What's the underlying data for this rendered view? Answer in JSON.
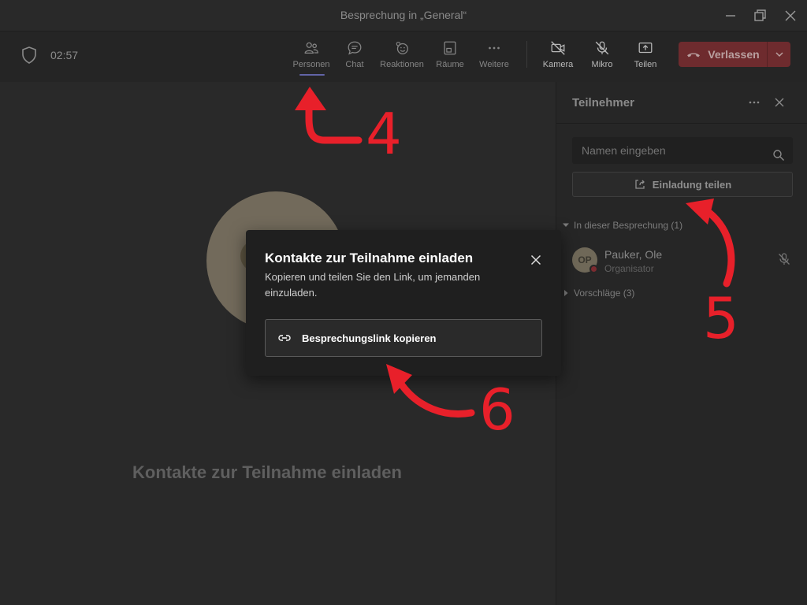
{
  "window": {
    "title": "Besprechung in „General“"
  },
  "toolbar": {
    "timer": "02:57",
    "buttons": {
      "people": "Personen",
      "chat": "Chat",
      "reactions": "Reaktionen",
      "rooms": "Räume",
      "more": "Weitere",
      "camera": "Kamera",
      "mic": "Mikro",
      "share": "Teilen"
    },
    "leave_label": "Verlassen"
  },
  "stage": {
    "title": "Kontakte zur Teilnahme einladen"
  },
  "panel": {
    "title": "Teilnehmer",
    "search_placeholder": "Namen eingeben",
    "share_invite_label": "Einladung teilen",
    "section_in_meeting": "In dieser Besprechung (1)",
    "section_suggestions": "Vorschläge (3)",
    "participants": [
      {
        "initials": "OP",
        "name": "Pauker, Ole",
        "role": "Organisator"
      }
    ]
  },
  "modal": {
    "title": "Kontakte zur Teilnahme einladen",
    "description": "Kopieren und teilen Sie den Link, um jemanden einzuladen.",
    "copy_button": "Besprechungslink kopieren"
  },
  "annotations": {
    "marker_4": "4",
    "marker_5": "5",
    "marker_6": "6"
  },
  "colors": {
    "accent": "#6264a7",
    "leave": "#6e2b2e",
    "annotation": "#e8202a"
  }
}
